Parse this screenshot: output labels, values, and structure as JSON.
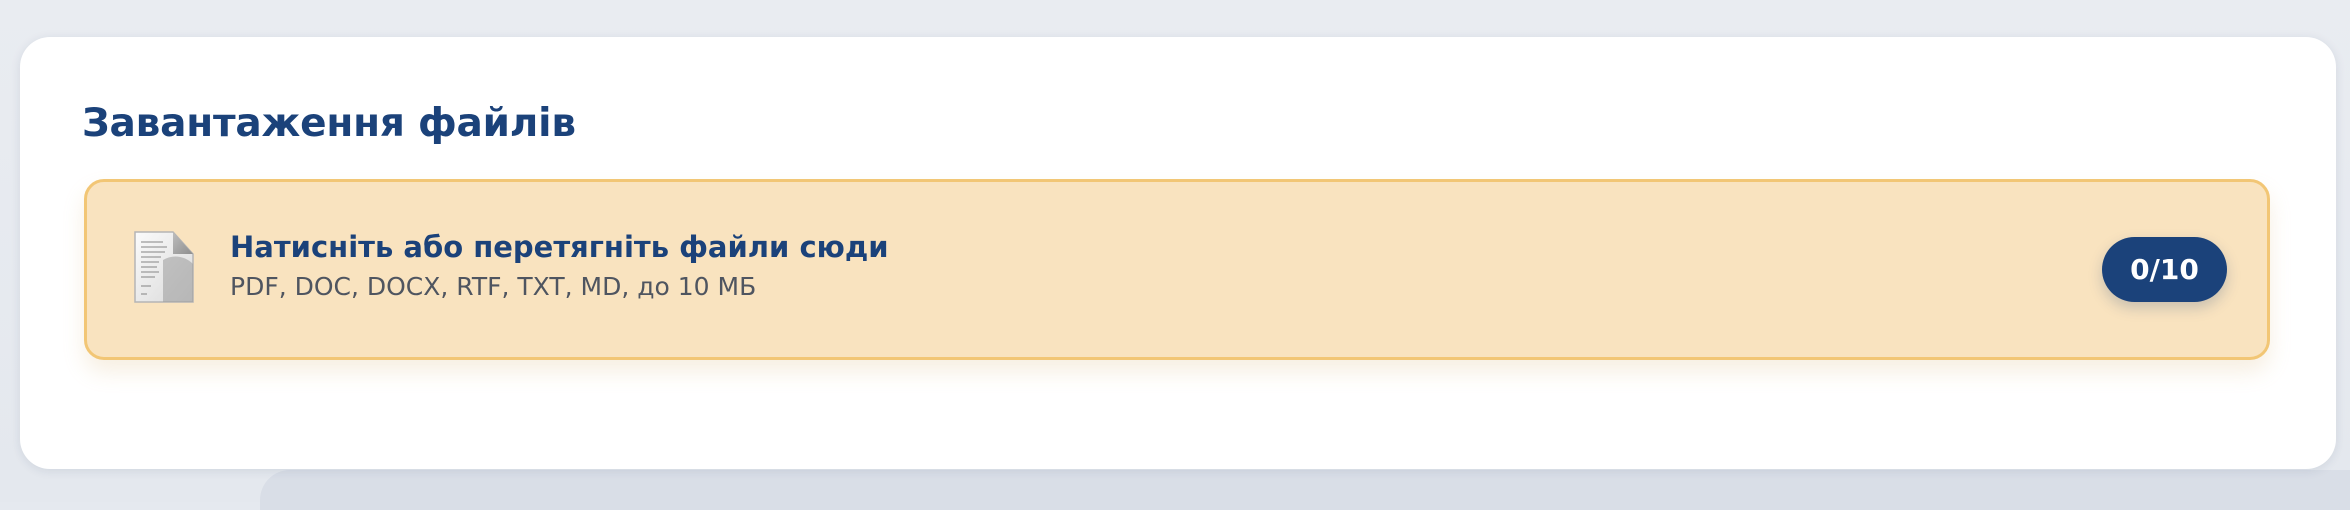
{
  "upload_card": {
    "title": "Завантаження файлів",
    "dropzone": {
      "title": "Натисніть або перетягніть файли сюди",
      "hint": "PDF, DOC, DOCX, RTF, TXT, MD, до 10 МБ",
      "icon": "document-icon",
      "counter": "0/10"
    }
  },
  "colors": {
    "accent": "#1b427a",
    "dropzone_bg": "#f9e3bf",
    "dropzone_border": "#f2c675",
    "card_bg": "#ffffff",
    "page_bg": "#e5e9ef"
  }
}
